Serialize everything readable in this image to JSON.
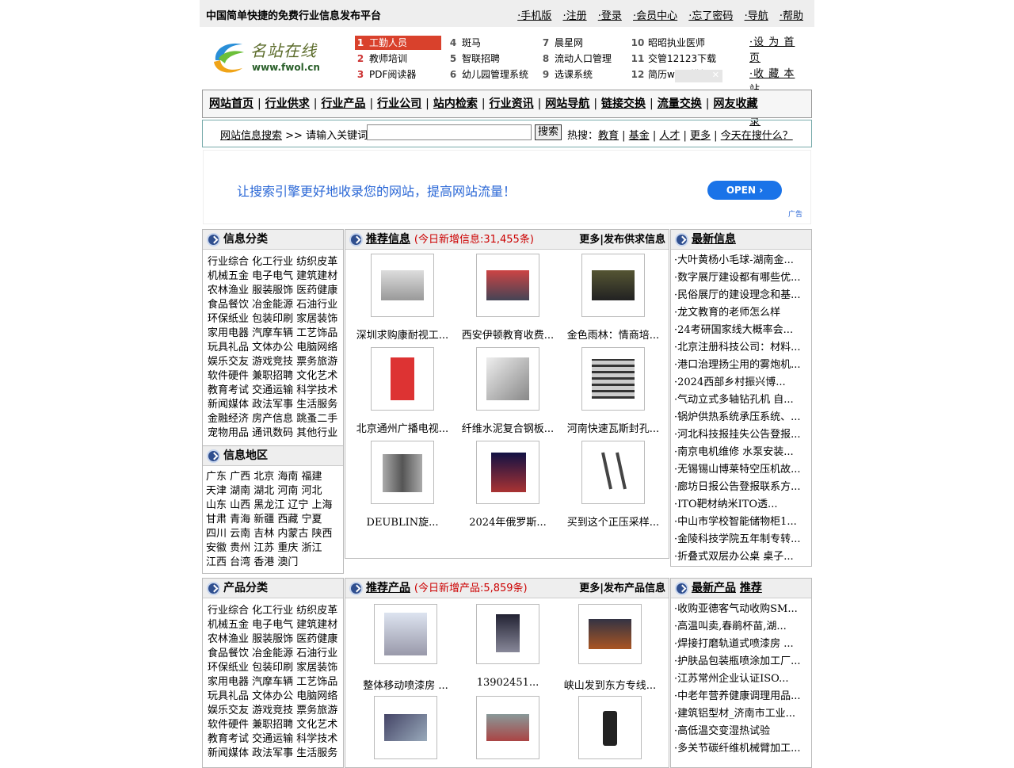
{
  "topbar": {
    "slogan": "中国简单快捷的免费行业信息发布平台",
    "links": [
      "·手机版",
      "·注册",
      "·登录",
      "·会员中心",
      "·忘了密码",
      "·导航",
      "·帮助"
    ]
  },
  "logo": {
    "name": "名站在线",
    "domain": "www.fwol.cn"
  },
  "hot": [
    {
      "num": "1",
      "label": "工勤人员"
    },
    {
      "num": "2",
      "label": "教师培训"
    },
    {
      "num": "3",
      "label": "PDF阅读器"
    },
    {
      "num": "4",
      "label": "斑马"
    },
    {
      "num": "5",
      "label": "智联招聘"
    },
    {
      "num": "6",
      "label": "幼儿园管理系统"
    },
    {
      "num": "7",
      "label": "晨星网"
    },
    {
      "num": "8",
      "label": "流动人口管理"
    },
    {
      "num": "9",
      "label": "选课系统"
    },
    {
      "num": "10",
      "label": "昭昭执业医师"
    },
    {
      "num": "11",
      "label": "交管12123下载"
    },
    {
      "num": "12",
      "label": "简历word模板"
    }
  ],
  "adclose": "✕",
  "sidelinks": [
    "·设 为 首 页",
    "·收 藏 本 站",
    "·新 站 登 录"
  ],
  "nav": [
    "网站首页",
    "行业供求",
    "行业产品",
    "行业公司",
    "站内检索",
    "行业资讯",
    "网站导航",
    "链接交换",
    "流量交换",
    "网友收藏"
  ],
  "nav_sep": "|",
  "search": {
    "link": "网站信息搜索",
    "prompt": " >> 请输入关键词: ",
    "button": "搜索",
    "hot_label": "热搜：",
    "hot": [
      "教育",
      "基金",
      "人才",
      "更多",
      "今天在搜什么？"
    ]
  },
  "ad": {
    "text": "让搜索引擎更好地收录您的网站，提高网站流量！",
    "button": "OPEN ›",
    "label": "广告"
  },
  "info_cat": {
    "title": "信息分类",
    "rows": [
      "行业综合 化工行业 纺织皮革",
      "机械五金 电子电气 建筑建材",
      "农林渔业 服装服饰 医药健康",
      "食品餐饮 冶金能源 石油行业",
      "环保纸业 包装印刷 家居装饰",
      "家用电器 汽摩车辆 工艺饰品",
      "玩具礼品 文体办公 电脑网络",
      "娱乐交友 游戏竞技 票务旅游",
      "软件硬件 兼职招聘 文化艺术",
      "教育考试 交通运输 科学技术",
      "新闻媒体 政法军事 生活服务",
      "金融经济 房产信息 跳蚤二手",
      "宠物用品 通讯数码 其他行业"
    ]
  },
  "region": {
    "title": "信息地区",
    "rows": [
      "广东 广西 北京 海南 福建",
      "天津 湖南 湖北 河南 河北",
      "山东 山西 黑龙江 辽宁 上海",
      "甘肃 青海 新疆 西藏 宁夏",
      "四川 云南 吉林 内蒙古 陕西",
      "安徽 贵州 江苏 重庆 浙江",
      "江西 台湾 香港 澳门"
    ]
  },
  "rec_info": {
    "title": "推荐信息",
    "count": "(今日新增信息:31,455条)",
    "right": "更多|发布供求信息",
    "items": [
      "深圳求购康耐视工...",
      "西安伊顿教育收费...",
      "金色雨林：情商培...",
      "北京通州广播电视...",
      "纤维水泥复合钢板...",
      "河南快速瓦斯封孔...",
      "DEUBLIN旋...",
      "2024年俄罗斯...",
      "买到这个正压采样..."
    ]
  },
  "latest_info": {
    "title": "最新信息",
    "items": [
      "·大叶黄杨小毛球-湖南金...",
      "·数字展厅建设都有哪些优...",
      "·民俗展厅的建设理念和基...",
      "·龙文教育的老师怎么样",
      "·24考研国家线大概率会...",
      "·北京注册科技公司：材料...",
      "·港口治理扬尘用的雾炮机...",
      "·2024西部乡村振兴博...",
      "·气动立式多轴钻孔机 自...",
      "·锅炉供热系统承压系统、...",
      "·河北科技报挂失公告登报...",
      "·南京电机维修 水泵安装...",
      "·无锡锡山博莱特空压机故...",
      "·廊坊日报公告登报联系方...",
      "·ITO靶材纳米ITO透...",
      "·中山市学校智能储物柜1...",
      "·金陵科技学院五年制专转...",
      "·折叠式双层办公桌 桌子..."
    ]
  },
  "prod_cat": {
    "title": "产品分类",
    "rows": [
      "行业综合 化工行业 纺织皮革",
      "机械五金 电子电气 建筑建材",
      "农林渔业 服装服饰 医药健康",
      "食品餐饮 冶金能源 石油行业",
      "环保纸业 包装印刷 家居装饰",
      "家用电器 汽摩车辆 工艺饰品",
      "玩具礼品 文体办公 电脑网络",
      "娱乐交友 游戏竞技 票务旅游",
      "软件硬件 兼职招聘 文化艺术",
      "教育考试 交通运输 科学技术",
      "新闻媒体 政法军事 生活服务"
    ]
  },
  "rec_prod": {
    "title": "推荐产品",
    "count": "(今日新增产品:5,859条)",
    "right": "更多|发布产品信息",
    "items": [
      "整体移动喷漆房 ...",
      "13902451...",
      "峡山发到东方专线...",
      "",
      "",
      ""
    ]
  },
  "latest_prod": {
    "title": "最新产品",
    "title2": "推荐",
    "items": [
      "·收购亚德客气动收购SM...",
      "·高温叫卖,春鹃杯苗,湖...",
      "·焊接打磨轨道式喷漆房 ...",
      "·护肤品包装瓶喷涂加工厂...",
      "·江苏常州企业认证ISO...",
      "·中老年营养健康调理用品...",
      "·建筑铝型材_济南市工业...",
      "·高低温交变湿热试验",
      "·多关节碳纤维机械臂加工..."
    ]
  },
  "colors": {
    "hot_selected": "#d9412c",
    "count_red": "#c00",
    "panel_head": "#eeeeee",
    "ad_blue": "#1a73e8"
  }
}
